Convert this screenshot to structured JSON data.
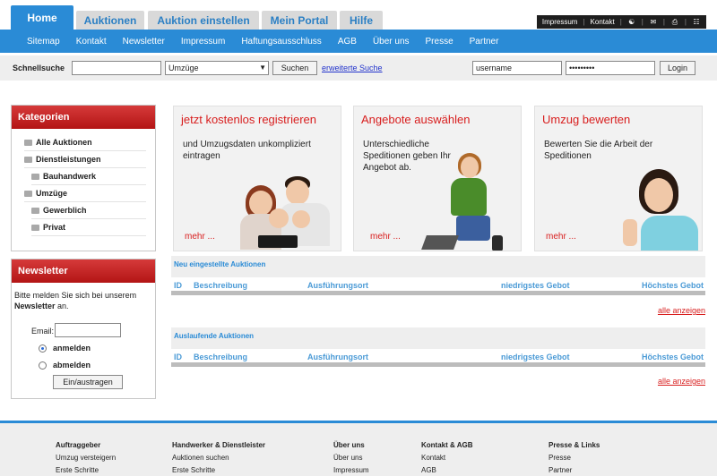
{
  "tabs": [
    "Home",
    "Auktionen",
    "Auktion einstellen",
    "Mein Portal",
    "Hilfe"
  ],
  "util": {
    "impressum": "Impressum",
    "kontakt": "Kontakt",
    "icons": [
      "users-icon",
      "mail-icon",
      "print-icon",
      "network-icon"
    ]
  },
  "nav": [
    "Sitemap",
    "Kontakt",
    "Newsletter",
    "Impressum",
    "Haftungsausschluss",
    "AGB",
    "Über uns",
    "Presse",
    "Partner"
  ],
  "search": {
    "label": "Schnellsuche",
    "query_value": "",
    "category_selected": "Umzüge",
    "button": "Suchen",
    "advanced_link": "erweiterte Suche"
  },
  "login": {
    "username_value": "username",
    "password_value": "•••••••••",
    "button": "Login"
  },
  "categories": {
    "title": "Kategorien",
    "items": [
      {
        "label": "Alle Auktionen",
        "sub": false
      },
      {
        "label": "Dienstleistungen",
        "sub": false
      },
      {
        "label": "Bauhandwerk",
        "sub": true
      },
      {
        "label": "Umzüge",
        "sub": false
      },
      {
        "label": "Gewerblich",
        "sub": true
      },
      {
        "label": "Privat",
        "sub": true
      }
    ]
  },
  "newsletter": {
    "title": "Newsletter",
    "text_prefix": "Bitte melden Sie sich bei unserem",
    "text_bold": "Newsletter",
    "text_suffix": "an.",
    "email_label": "Email:",
    "email_value": "",
    "opt_on": "anmelden",
    "opt_off": "abmelden",
    "selected": "anmelden",
    "button": "Ein/austragen"
  },
  "promos": [
    {
      "title": "jetzt kostenlos registrieren",
      "text": "und Umzugsdaten unkompliziert eintragen",
      "more": "mehr ..."
    },
    {
      "title": "Angebote auswählen",
      "text": "Unterschiedliche Speditionen geben Ihr Angebot ab.",
      "more": "mehr ..."
    },
    {
      "title": "Umzug bewerten",
      "text": "Bewerten Sie die Arbeit der Speditionen",
      "more": "mehr ..."
    }
  ],
  "tables": [
    {
      "title": "Neu eingestellte Auktionen",
      "columns": [
        "ID",
        "Beschreibung",
        "Ausführungsort",
        "niedrigstes Gebot",
        "Höchstes Gebot"
      ],
      "link": "alle anzeigen"
    },
    {
      "title": "Auslaufende Auktionen",
      "columns": [
        "ID",
        "Beschreibung",
        "Ausführungsort",
        "niedrigstes Gebot",
        "Höchstes Gebot"
      ],
      "link": "alle anzeigen"
    }
  ],
  "footer": [
    {
      "heading": "Auftraggeber",
      "links": [
        "Umzug versteigern",
        "Erste Schritte"
      ]
    },
    {
      "heading": "Handwerker & Dienstleister",
      "links": [
        "Auktionen suchen",
        "Erste Schritte"
      ]
    },
    {
      "heading": "Über uns",
      "links": [
        "Über uns",
        "Impressum"
      ]
    },
    {
      "heading": "Kontakt & AGB",
      "links": [
        "Kontakt",
        "AGB"
      ]
    },
    {
      "heading": "Presse & Links",
      "links": [
        "Presse",
        "Partner"
      ]
    }
  ],
  "colors": {
    "brand_blue": "#2a8bd6",
    "red": "#d81e1e",
    "header_red": "#c21f1f"
  }
}
